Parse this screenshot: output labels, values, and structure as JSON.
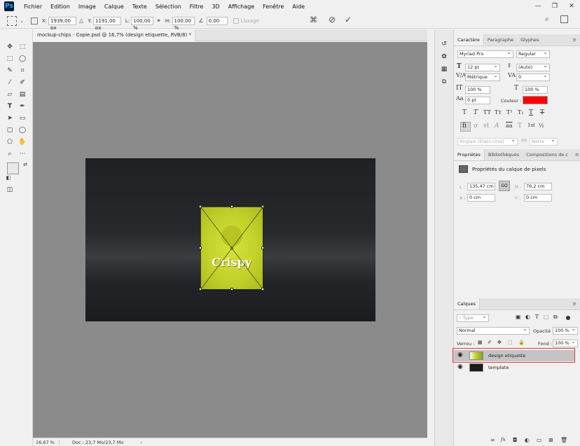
{
  "app": {
    "logo": "Ps"
  },
  "menu": [
    "Fichier",
    "Edition",
    "Image",
    "Calque",
    "Texte",
    "Sélection",
    "Filtre",
    "3D",
    "Affichage",
    "Fenêtre",
    "Aide"
  ],
  "window_controls": [
    "—",
    "❐",
    "✕"
  ],
  "options": {
    "x_label": "X:",
    "x_value": "1939,00 px",
    "y_label": "Y:",
    "y_value": "1191,00 px",
    "w_label": "L:",
    "w_value": "100,00 %",
    "h_label": "H:",
    "h_value": "100,00 %",
    "angle_value": "0,00",
    "smoothing": "Lissage"
  },
  "document_tab": {
    "title": "mockup-chips - Copie.psd @ 16,7% (design etiquette, RVB/8) *",
    "close": "×"
  },
  "canvas": {
    "label_text": "Crispy"
  },
  "status": {
    "zoom": "16,67 %",
    "doc": "Doc : 23,7 Mo/23,7 Mo"
  },
  "character_panel": {
    "tabs": [
      "Caractère",
      "Paragraphe",
      "Glyphes"
    ],
    "font_family": "Myriad Pro",
    "font_style": "Regular",
    "size": "12 pt",
    "leading": "(Auto)",
    "kerning": "Métrique",
    "tracking": "0",
    "vscale": "100 %",
    "hscale": "100 %",
    "baseline": "0 pt",
    "color_label": "Couleur :",
    "color": "#ff0000",
    "glyph_row1": [
      "T",
      "T",
      "TT",
      "Tт",
      "T¹",
      "T₁",
      "T",
      "T"
    ],
    "glyph_row2": [
      "fi",
      "ơ",
      "st",
      "A",
      "aa",
      "T",
      "1st",
      "½"
    ],
    "language": "Anglais (Etats-Unis)",
    "antialias": "Nette"
  },
  "properties_panel": {
    "tabs": [
      "Propriétés",
      "Bibliothèques",
      "Compositions de c"
    ],
    "title": "Propriétés du calque de pixels",
    "w_label": "L :",
    "w_value": "135,47 cm",
    "link_label": "GO",
    "h_label": "H :",
    "h_value": "76,2 cm",
    "x_label": "X :",
    "x_value": "0 cm",
    "y_label": "Y :",
    "y_value": "0 cm"
  },
  "layers_panel": {
    "tab": "Calques",
    "filter": "Type",
    "blend_mode": "Normal",
    "opacity_label": "Opacité :",
    "opacity": "100 %",
    "lock_label": "Verrou :",
    "fill_label": "Fond :",
    "fill": "100 %",
    "layers": [
      {
        "name": "design etiquette",
        "selected": true
      },
      {
        "name": "template",
        "selected": false
      }
    ],
    "bottom_icons": [
      "∞",
      "fx",
      "◘",
      "◐",
      "▭",
      "⊞",
      "🗑"
    ]
  }
}
